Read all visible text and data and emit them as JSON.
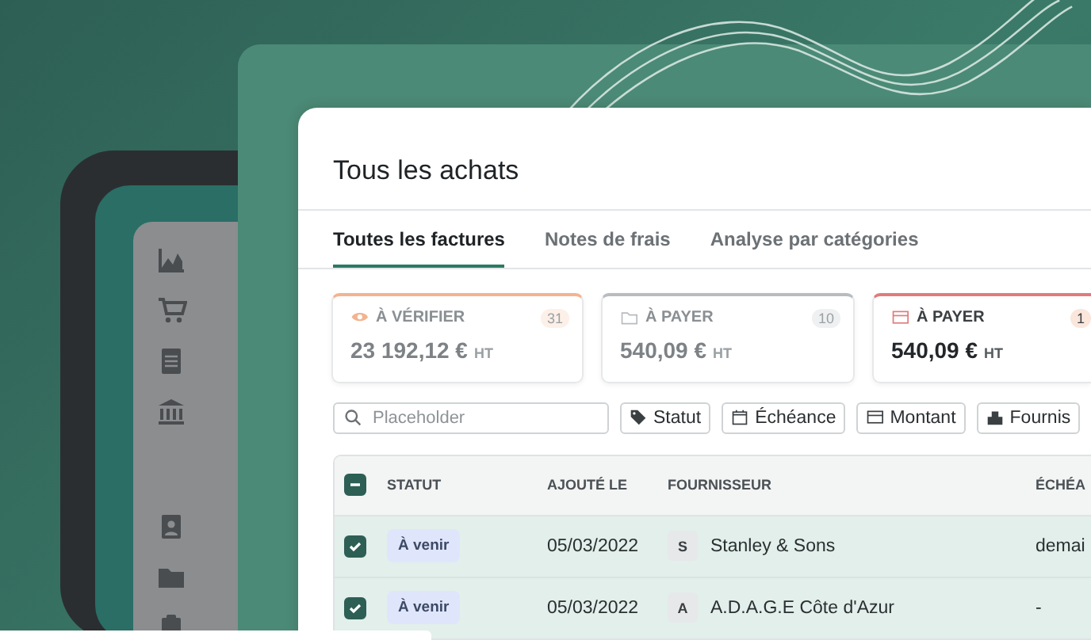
{
  "page": {
    "title": "Tous les achats"
  },
  "tabs": [
    {
      "label": "Toutes les factures",
      "selected": true
    },
    {
      "label": "Notes de frais",
      "selected": false
    },
    {
      "label": "Analyse par catégories",
      "selected": false
    }
  ],
  "summary_cards": [
    {
      "kind": "eye",
      "label": "À VÉRIFIER",
      "count": "31",
      "amount": "23 192,12 €",
      "unit": "HT",
      "color": "#f2b48f",
      "selected": false
    },
    {
      "kind": "folder",
      "label": "À PAYER",
      "count": "10",
      "amount": "540,09 €",
      "unit": "HT",
      "color": "#b8bcc0",
      "selected": false
    },
    {
      "kind": "card",
      "label": "À PAYER",
      "count": "1",
      "amount": "540,09 €",
      "unit": "HT",
      "color": "#e07b7b",
      "selected": true
    }
  ],
  "search": {
    "placeholder": "Placeholder"
  },
  "filters": [
    {
      "kind": "tag",
      "label": "Statut"
    },
    {
      "kind": "calendar",
      "label": "Échéance"
    },
    {
      "kind": "card",
      "label": "Montant"
    },
    {
      "kind": "building",
      "label": "Fournis"
    }
  ],
  "table": {
    "select_all": {
      "checked": true,
      "indeterminate": true
    },
    "columns": [
      "STATUT",
      "AJOUTÉ LE",
      "FOURNISSEUR",
      "ÉCHÉA"
    ],
    "rows": [
      {
        "checked": true,
        "status": "À venir",
        "added": "05/03/2022",
        "supplier_initial": "S",
        "supplier": "Stanley & Sons",
        "due": "demai"
      },
      {
        "checked": true,
        "status": "À venir",
        "added": "05/03/2022",
        "supplier_initial": "A",
        "supplier": "A.D.A.G.E Côte d'Azur",
        "due": "-"
      }
    ]
  },
  "sidebar": {
    "items": [
      {
        "kind": "chart"
      },
      {
        "kind": "cart"
      },
      {
        "kind": "document"
      },
      {
        "kind": "bank"
      },
      {
        "kind": "badge"
      },
      {
        "kind": "folder"
      },
      {
        "kind": "clipboard"
      }
    ]
  }
}
